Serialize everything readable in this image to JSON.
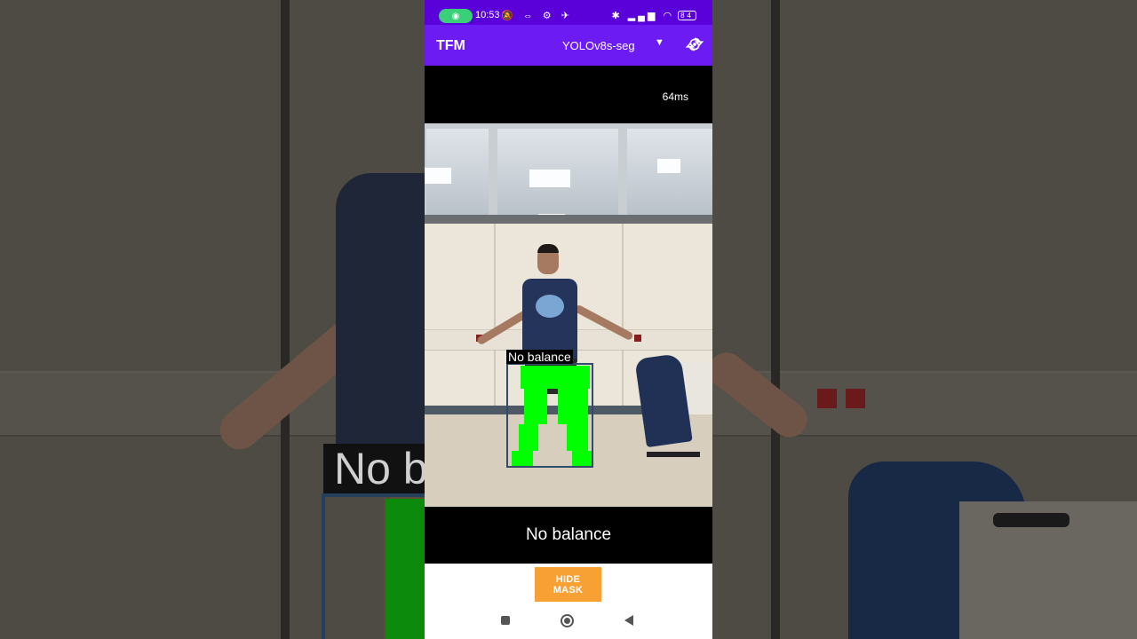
{
  "status_bar": {
    "time": "10:53",
    "left_icons": "🔕 ⇔ ⚙ ✈",
    "right_icons": "✱ ▂▄▆ ◠",
    "battery": "84"
  },
  "app_bar": {
    "title": "TFM",
    "model_selected": "YOLOv8s-seg",
    "dropdown_icon": "caret-down",
    "switch_camera_icon": "switch-camera"
  },
  "inference": {
    "latency": "64ms"
  },
  "detection": {
    "label": "No balance"
  },
  "result": {
    "text": "No balance"
  },
  "controls": {
    "hide_mask_label": "HIDE MASK"
  },
  "background_overlay": {
    "label_fragment": "No b"
  },
  "colors": {
    "status_bar": "#5a00d8",
    "app_bar": "#6c1cf2",
    "mask": "#00ff00",
    "button": "#f7a034",
    "box": "#2f4c6b"
  }
}
